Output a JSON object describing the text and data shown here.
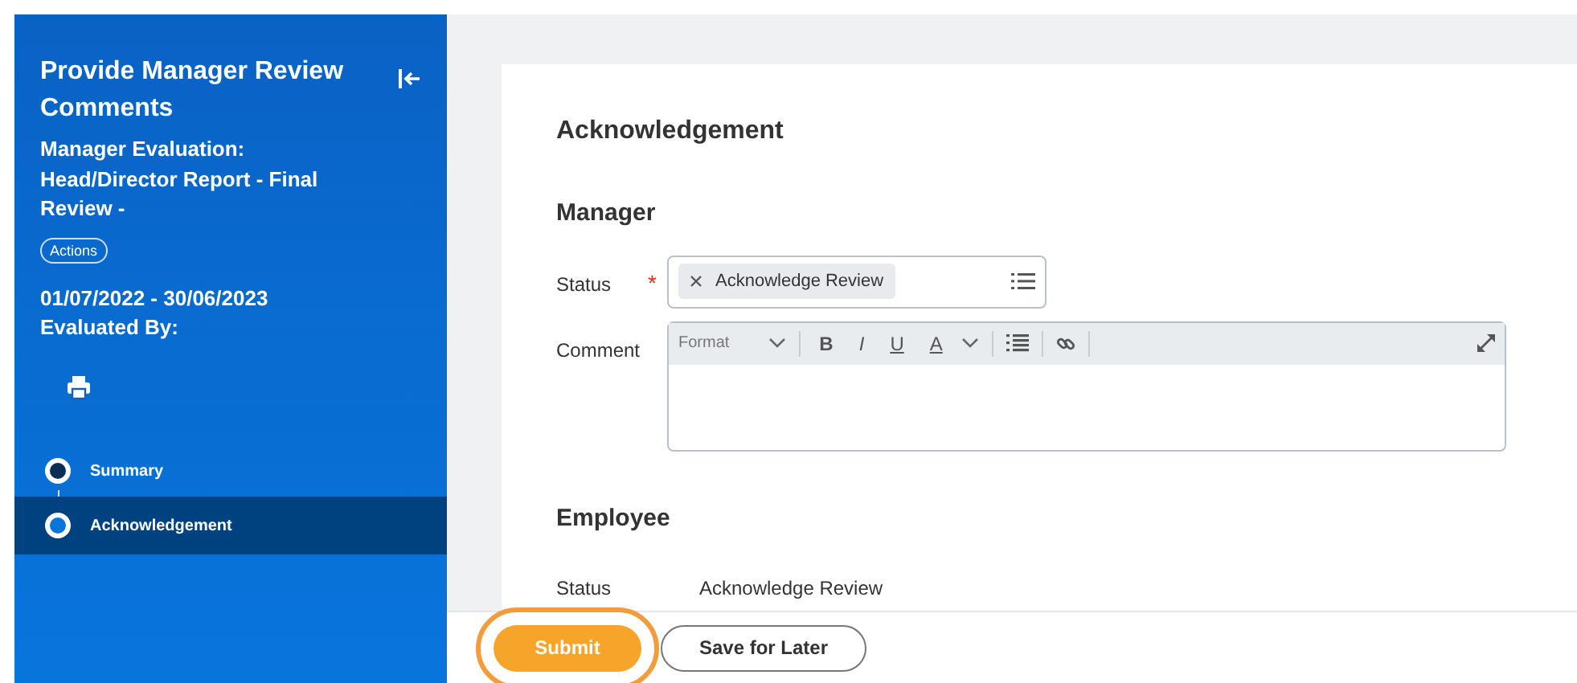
{
  "sidebar": {
    "title": "Provide Manager Review Comments",
    "subtitle": "Manager Evaluation: Head/Director Report - Final Review -",
    "actions_label": "Actions",
    "period": "01/07/2022 - 30/06/2023",
    "evaluated_by_label": "Evaluated By:",
    "steps": [
      {
        "label": "Summary",
        "selected": false
      },
      {
        "label": "Acknowledgement",
        "selected": true
      }
    ]
  },
  "main": {
    "heading": "Acknowledgement",
    "sections": [
      {
        "title": "Manager",
        "fields": [
          {
            "kind": "select",
            "label": "Status",
            "required_mark": "*",
            "value": "Acknowledge Review"
          },
          {
            "kind": "editor",
            "label": "Comment",
            "format_placeholder": "Format",
            "toolbar_buttons": [
              "B",
              "I",
              "U",
              "A"
            ]
          }
        ]
      },
      {
        "title": "Employee",
        "fields": [
          {
            "kind": "text",
            "label": "Status",
            "value": "Acknowledge Review"
          }
        ]
      }
    ]
  },
  "footer": {
    "buttons": [
      {
        "label": "Submit",
        "kind": "primary",
        "highlighted": true
      },
      {
        "label": "Save for Later",
        "kind": "secondary",
        "highlighted": false
      }
    ]
  }
}
